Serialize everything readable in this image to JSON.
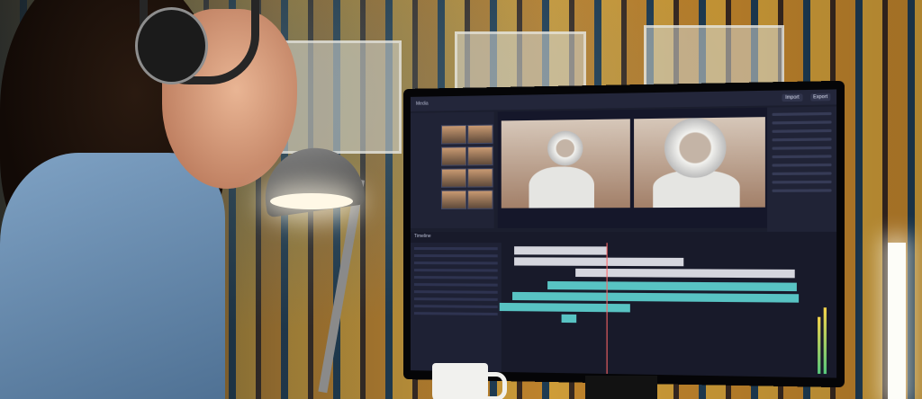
{
  "screen": {
    "titlebar": {
      "app_tab": "Media",
      "import_label": "Import",
      "export_label": "Export"
    },
    "timeline": {
      "header": "Timeline"
    }
  },
  "colors": {
    "screen_background": "#1b1e2e",
    "audio_clip": "#58c3c3",
    "video_clip": "#d5d6de",
    "playhead": "#ff6565"
  }
}
